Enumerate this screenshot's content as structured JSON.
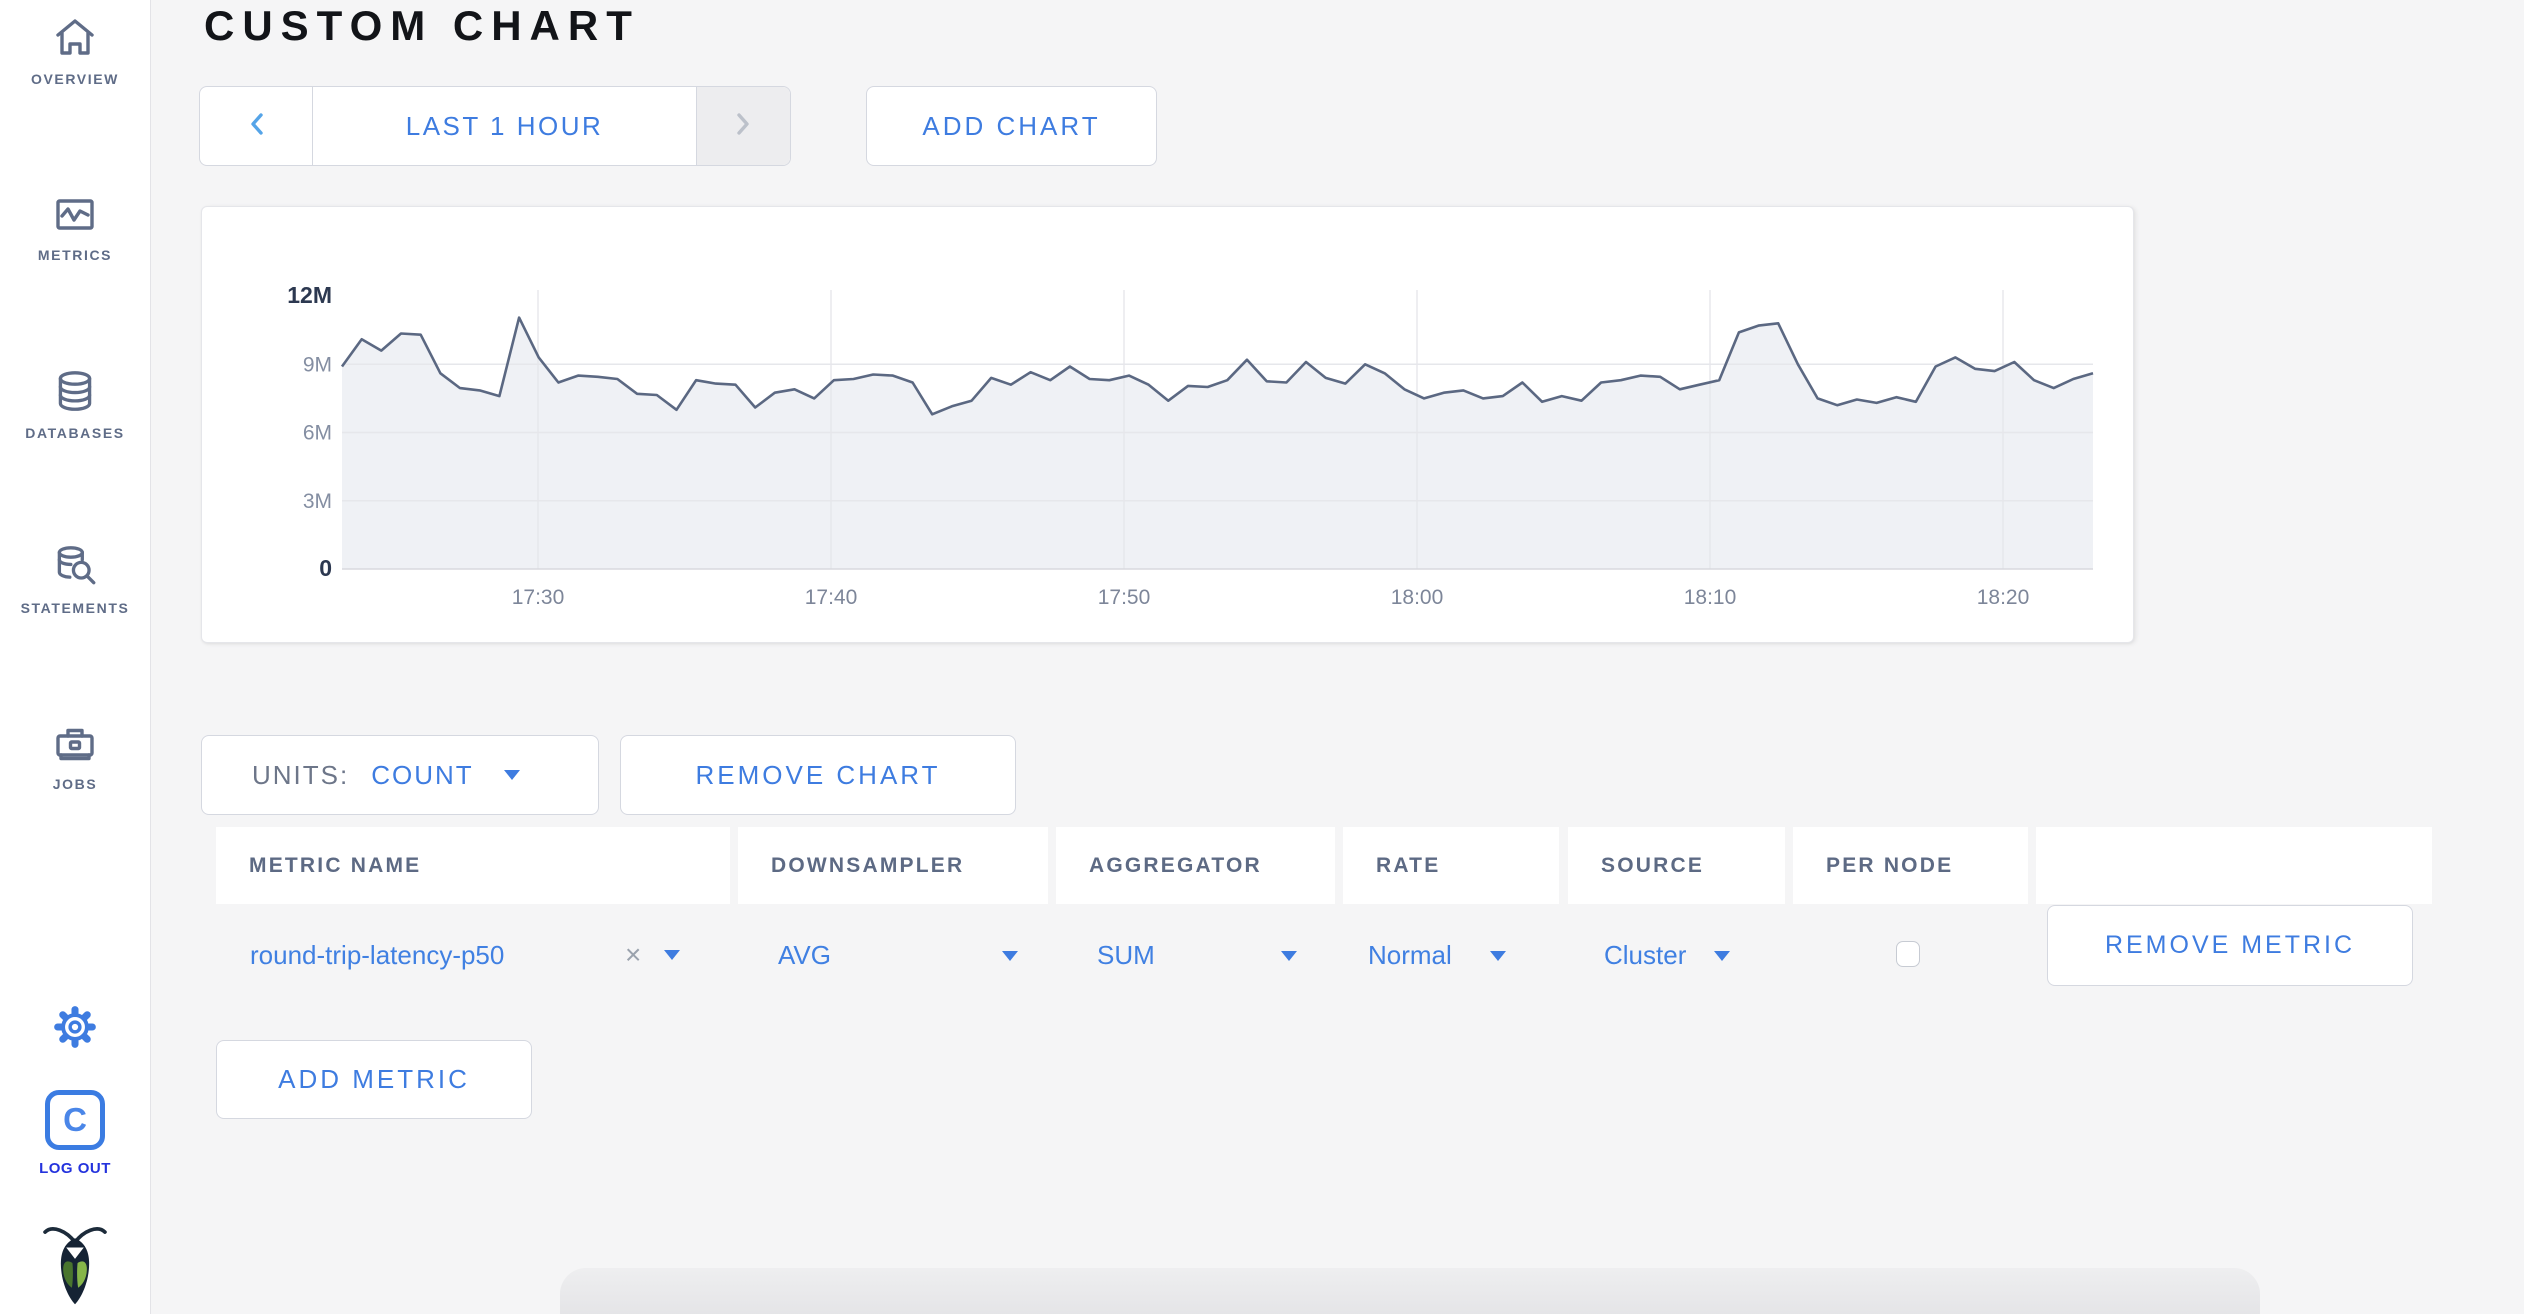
{
  "page": {
    "title": "CUSTOM CHART"
  },
  "sidebar": {
    "items": [
      {
        "label": "OVERVIEW",
        "icon": "home-icon"
      },
      {
        "label": "METRICS",
        "icon": "metrics-icon"
      },
      {
        "label": "DATABASES",
        "icon": "databases-icon"
      },
      {
        "label": "STATEMENTS",
        "icon": "statements-icon"
      },
      {
        "label": "JOBS",
        "icon": "jobs-icon"
      }
    ],
    "bottom": {
      "gear_icon": "gear-icon",
      "logo_letter": "C",
      "logout_label": "LOG OUT",
      "bug_icon": "cockroach-logo"
    }
  },
  "toolbar": {
    "time_range_label": "LAST 1 HOUR",
    "add_chart_label": "ADD CHART"
  },
  "chart_data": {
    "type": "area",
    "title": "",
    "series": [
      {
        "name": "round-trip-latency-p50",
        "values_millions": [
          8.9,
          10.1,
          9.6,
          10.35,
          10.3,
          8.6,
          7.95,
          7.85,
          7.6,
          11.05,
          9.3,
          8.2,
          8.5,
          8.45,
          8.35,
          7.7,
          7.65,
          7.0,
          8.3,
          8.15,
          8.1,
          7.1,
          7.75,
          7.9,
          7.5,
          8.3,
          8.35,
          8.55,
          8.5,
          8.2,
          6.8,
          7.15,
          7.4,
          8.4,
          8.1,
          8.65,
          8.3,
          8.9,
          8.35,
          8.3,
          8.5,
          8.1,
          7.4,
          8.05,
          8.0,
          8.3,
          9.2,
          8.25,
          8.2,
          9.1,
          8.4,
          8.15,
          9.0,
          8.6,
          7.9,
          7.5,
          7.75,
          7.85,
          7.5,
          7.6,
          8.2,
          7.35,
          7.6,
          7.4,
          8.2,
          8.3,
          8.5,
          8.45,
          7.9,
          8.1,
          8.3,
          10.4,
          10.7,
          10.8,
          9.0,
          7.5,
          7.2,
          7.45,
          7.3,
          7.55,
          7.35,
          8.9,
          9.3,
          8.8,
          8.7,
          9.1,
          8.3,
          7.95,
          8.35,
          8.6
        ]
      }
    ],
    "x_ticks": [
      "17:30",
      "17:40",
      "17:50",
      "18:00",
      "18:10",
      "18:20"
    ],
    "y_ticks": [
      "0",
      "3M",
      "6M",
      "9M",
      "12M"
    ],
    "y_tick_values": [
      0,
      3,
      6,
      9,
      12
    ],
    "ylim_millions": [
      0,
      12
    ],
    "units": "count",
    "grid": true,
    "legend": "none",
    "line_color": "#5b6882",
    "fill_color": "#eff1f5"
  },
  "chart_controls": {
    "units_label": "UNITS:",
    "units_value": "COUNT",
    "remove_chart_label": "REMOVE CHART",
    "add_metric_label": "ADD METRIC"
  },
  "metrics_table": {
    "columns": [
      "METRIC NAME",
      "DOWNSAMPLER",
      "AGGREGATOR",
      "RATE",
      "SOURCE",
      "PER NODE",
      ""
    ],
    "rows": [
      {
        "metric_name": "round-trip-latency-p50",
        "clear_icon": "×",
        "downsampler": "AVG",
        "aggregator": "SUM",
        "rate": "Normal",
        "source": "Cluster",
        "per_node_checked": false,
        "remove_label": "REMOVE METRIC"
      }
    ]
  },
  "colors": {
    "link_blue": "#3e7ce0",
    "logout_blue": "#2433dd",
    "slate": "#5f6c87",
    "page_bg": "#f5f5f6",
    "card_bg": "#ffffff"
  }
}
